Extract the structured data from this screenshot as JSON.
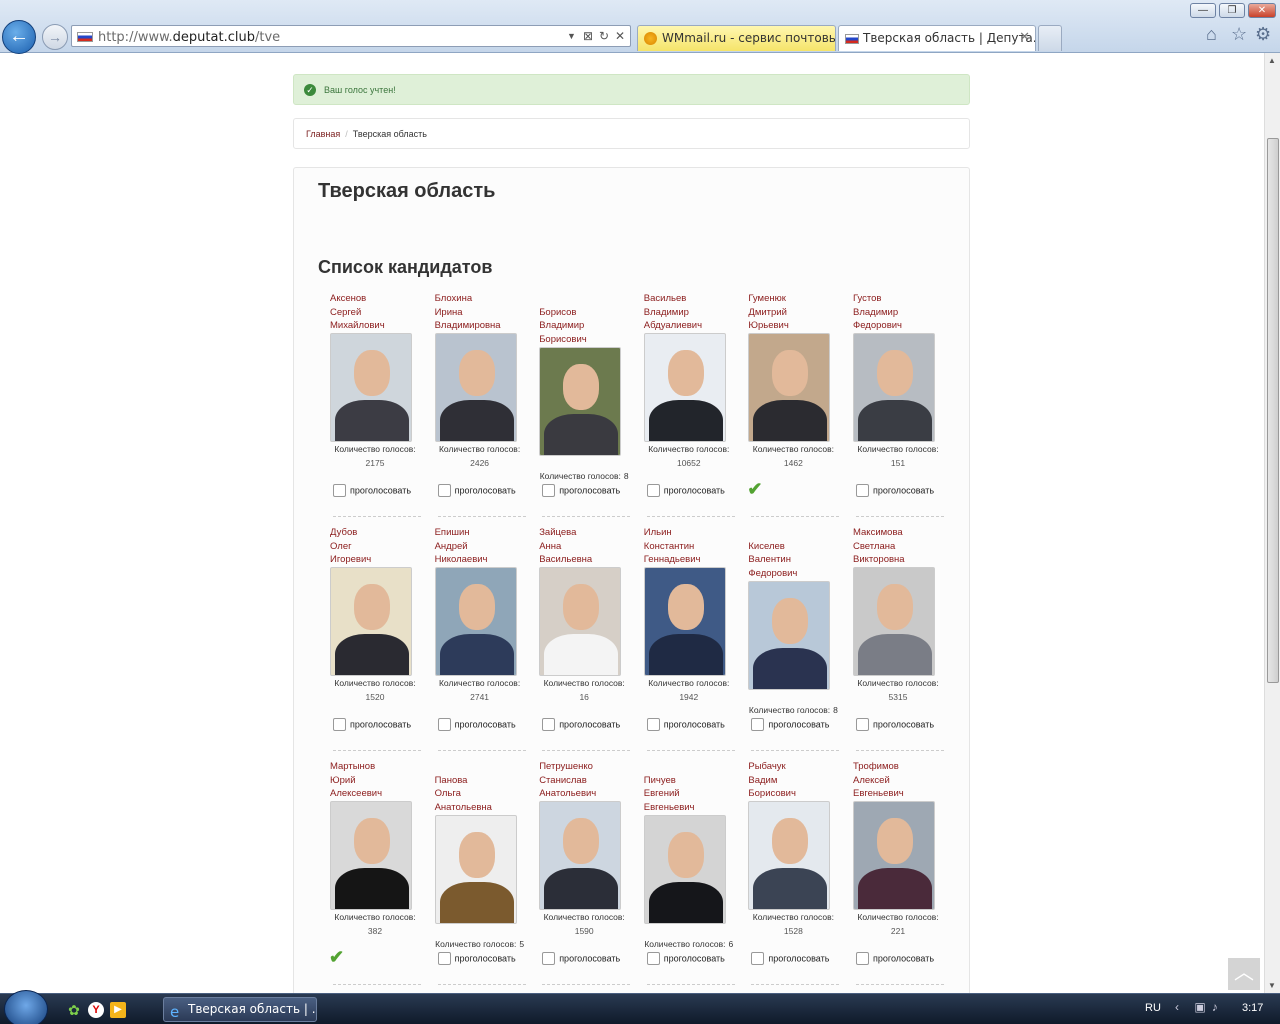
{
  "browser": {
    "url_prefix": "http://www.",
    "url_domain": "deputat.club",
    "url_path": "/tve",
    "tabs": [
      {
        "label": "WMmail.ru - сервис почтовы..."
      },
      {
        "label": "Тверская область | Депута..."
      }
    ],
    "close": "✕",
    "win_min": "—",
    "win_max": "❐",
    "win_close": "✕"
  },
  "alert": {
    "message": "Ваш голос учтен!"
  },
  "breadcrumb": {
    "home": "Главная",
    "sep": "/",
    "current": "Тверская область"
  },
  "page": {
    "title": "Тверская область",
    "list_title": "Список кандидатов"
  },
  "labels": {
    "votes": "Количество голосов:",
    "vote_action": "проголосовать"
  },
  "candidates": [
    {
      "last": "Аксенов",
      "first": "Сергей",
      "middle": "Михайлович",
      "votes": "2175",
      "voted": false
    },
    {
      "last": "Блохина",
      "first": "Ирина",
      "middle": "Владимировна",
      "votes": "2426",
      "voted": false
    },
    {
      "last": "Борисов",
      "first": "Владимир",
      "middle": "Борисович",
      "votes": "8",
      "voted": false
    },
    {
      "last": "Васильев",
      "first": "Владимир",
      "middle": "Абдуалиевич",
      "votes": "10652",
      "voted": false
    },
    {
      "last": "Гуменюк",
      "first": "Дмитрий",
      "middle": "Юрьевич",
      "votes": "1462",
      "voted": true
    },
    {
      "last": "Густов",
      "first": "Владимир",
      "middle": "Федорович",
      "votes": "151",
      "voted": false
    },
    {
      "last": "Дубов",
      "first": "Олег",
      "middle": "Игоревич",
      "votes": "1520",
      "voted": false
    },
    {
      "last": "Епишин",
      "first": "Андрей",
      "middle": "Николаевич",
      "votes": "2741",
      "voted": false
    },
    {
      "last": "Зайцева",
      "first": "Анна",
      "middle": "Васильевна",
      "votes": "16",
      "voted": false
    },
    {
      "last": "Ильин",
      "first": "Константин",
      "middle": "Геннадьевич",
      "votes": "1942",
      "voted": false
    },
    {
      "last": "Киселев",
      "first": "Валентин",
      "middle": "Федорович",
      "votes": "8",
      "voted": false
    },
    {
      "last": "Максимова",
      "first": "Светлана",
      "middle": "Викторовна",
      "votes": "5315",
      "voted": false
    },
    {
      "last": "Мартынов",
      "first": "Юрий",
      "middle": "Алексеевич",
      "votes": "382",
      "voted": true
    },
    {
      "last": "Панова",
      "first": "Ольга",
      "middle": "Анатольевна",
      "votes": "5",
      "voted": false
    },
    {
      "last": "Петрушенко",
      "first": "Станислав",
      "middle": "Анатольевич",
      "votes": "1590",
      "voted": false
    },
    {
      "last": "Пичуев",
      "first": "Евгений",
      "middle": "Евгеньевич",
      "votes": "6",
      "voted": false
    },
    {
      "last": "Рыбачук",
      "first": "Вадим",
      "middle": "Борисович",
      "votes": "1528",
      "voted": false
    },
    {
      "last": "Трофимов",
      "first": "Алексей",
      "middle": "Евгеньевич",
      "votes": "221",
      "voted": false
    }
  ],
  "taskbar": {
    "task_label": "Тверская область | ...",
    "lang": "RU",
    "clock": "3:17"
  },
  "colors": {
    "link": "#8b1c1c",
    "alert_bg": "#dff0d8",
    "check": "#53a332"
  }
}
